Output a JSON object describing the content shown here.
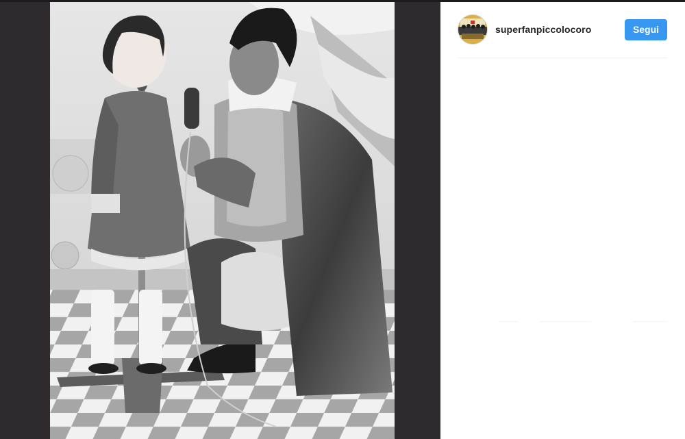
{
  "post": {
    "username": "superfanpiccolocoro",
    "follow_label": "Segui"
  },
  "avatar": {
    "icon": "group-photo-avatar",
    "ring_color": "#c9a23a"
  },
  "colors": {
    "background": "#2e2a2d",
    "follow_button": "#3897f0",
    "username_text": "#262626"
  },
  "photo": {
    "description_icon": "black-and-white-photo"
  }
}
